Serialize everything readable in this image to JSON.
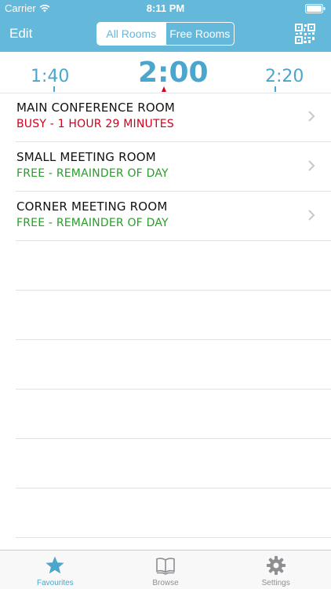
{
  "status_bar": {
    "carrier": "Carrier",
    "time": "8:11 PM"
  },
  "nav": {
    "edit_label": "Edit",
    "segments": [
      {
        "label": "All Rooms",
        "active": true
      },
      {
        "label": "Free Rooms",
        "active": false
      }
    ],
    "qr_icon": "qr-code-icon"
  },
  "timeline": {
    "left_tick": "1:40",
    "current": "2:00",
    "right_tick": "2:20"
  },
  "rooms": [
    {
      "name": "MAIN CONFERENCE ROOM",
      "status": "BUSY - 1 HOUR 29 MINUTES",
      "state": "busy"
    },
    {
      "name": "SMALL MEETING ROOM",
      "status": "FREE - REMAINDER OF DAY",
      "state": "free"
    },
    {
      "name": "CORNER MEETING ROOM",
      "status": "FREE - REMAINDER OF DAY",
      "state": "free"
    }
  ],
  "tabs": [
    {
      "label": "Favourites",
      "icon": "star-icon",
      "active": true
    },
    {
      "label": "Browse",
      "icon": "book-icon",
      "active": false
    },
    {
      "label": "Settings",
      "icon": "gear-icon",
      "active": false
    }
  ],
  "colors": {
    "accent": "#64b8d9",
    "busy": "#d0021b",
    "free": "#2a9d2a"
  }
}
